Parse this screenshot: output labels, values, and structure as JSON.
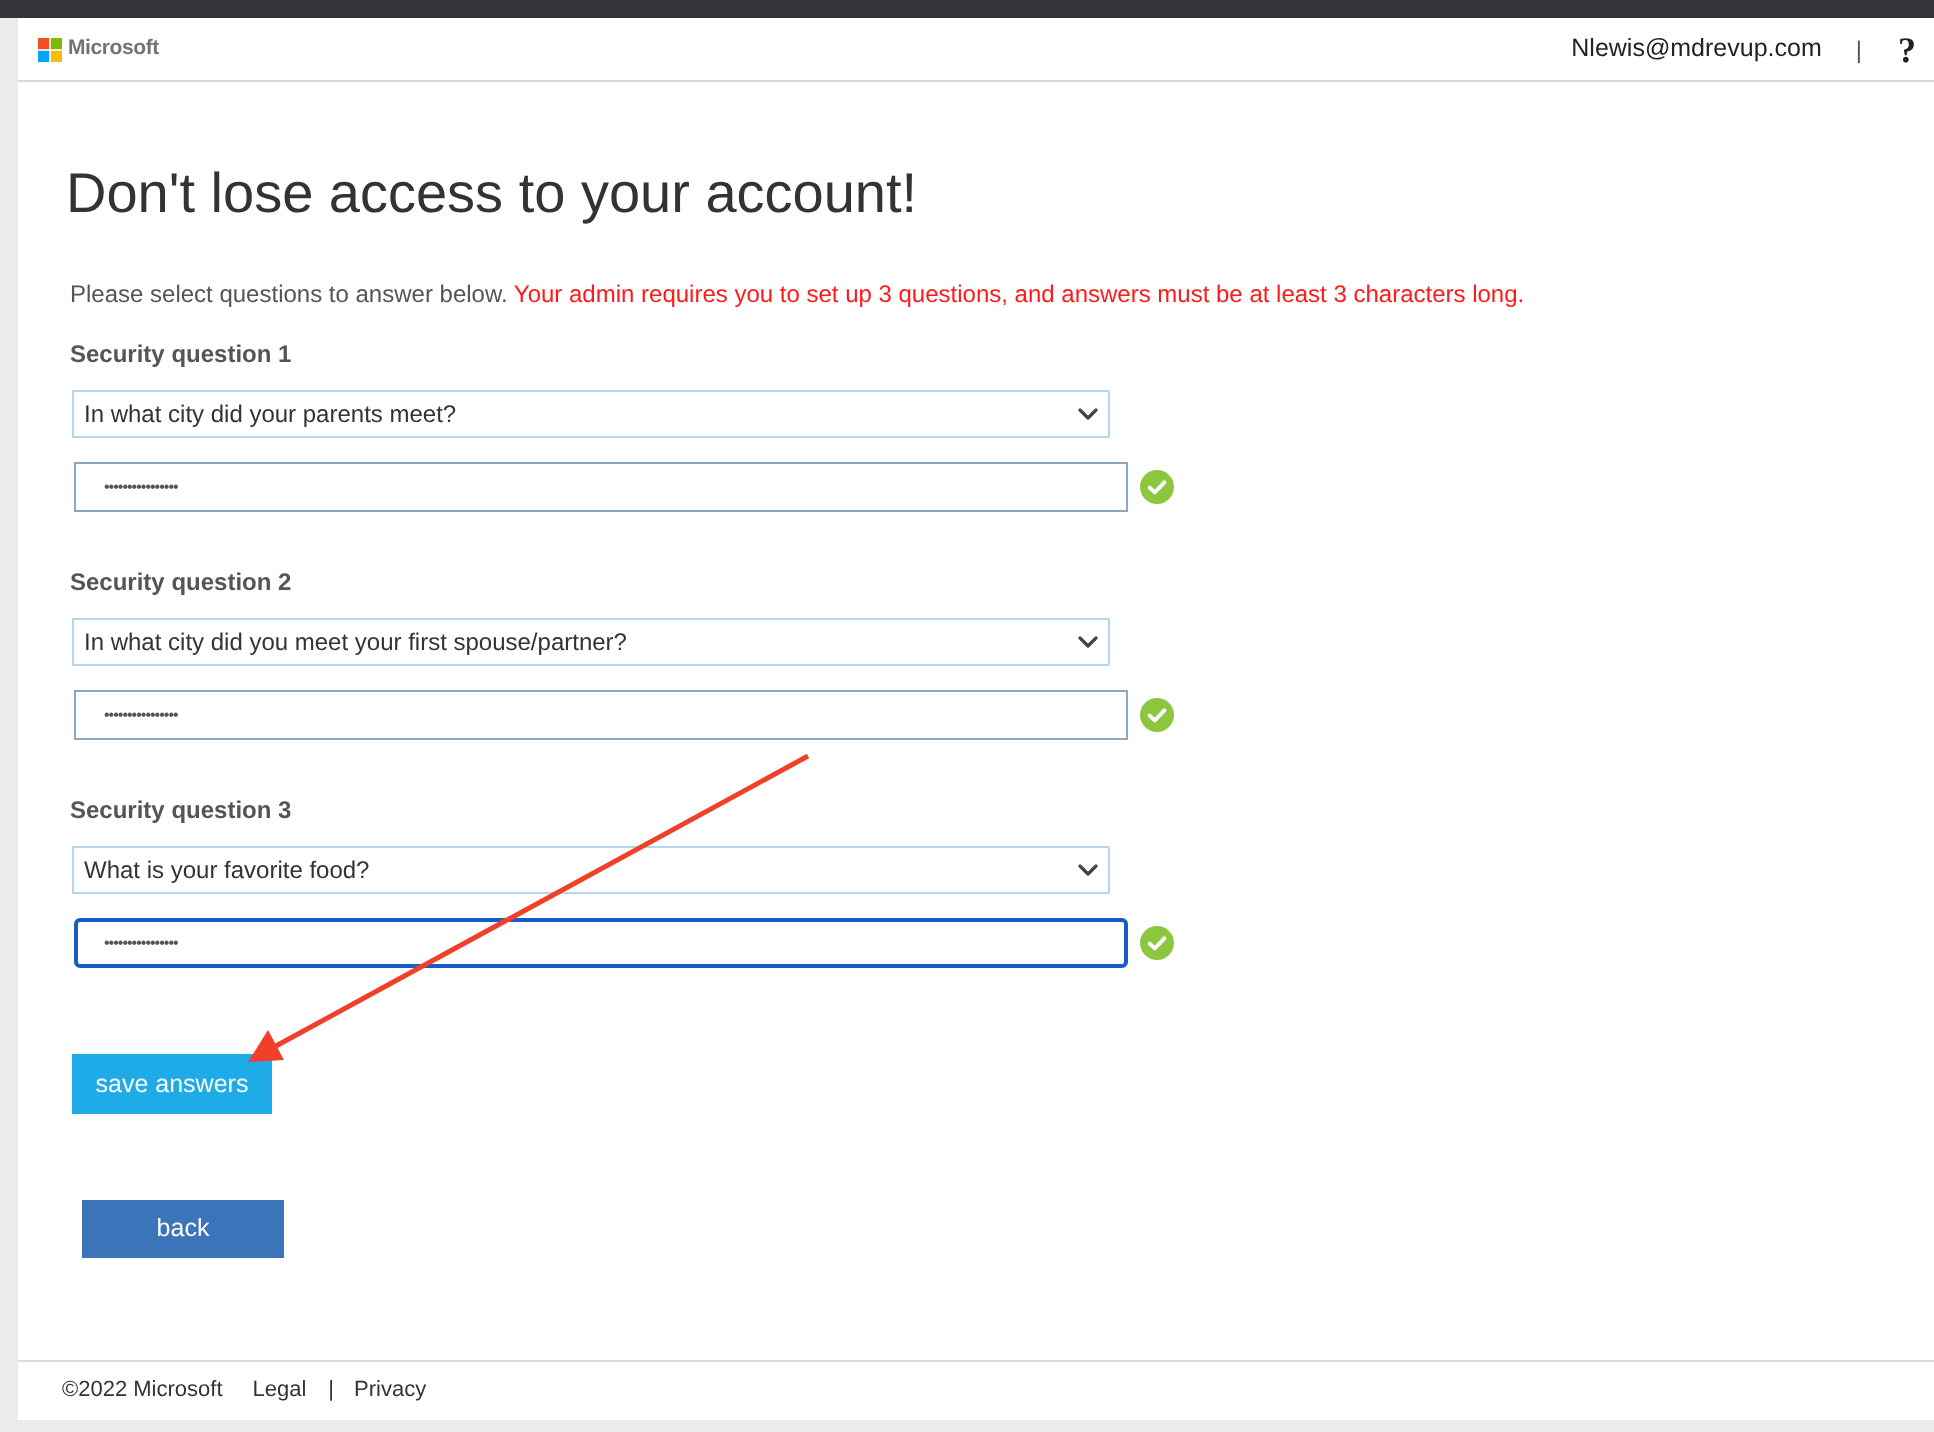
{
  "header": {
    "brand": "Microsoft",
    "user": "Nlewis@mdrevup.com",
    "separator": "|",
    "help": "?"
  },
  "title": "Don't lose access to your account!",
  "intro": {
    "text": "Please select questions to answer below.",
    "warning": "Your admin requires you to set up 3 questions, and answers must be at least 3 characters long."
  },
  "questions": [
    {
      "label": "Security question 1",
      "question": "In what city did your parents meet?",
      "answer": "••••••••••••••••",
      "focused": false,
      "valid": true
    },
    {
      "label": "Security question 2",
      "question": "In what city did you meet your first spouse/partner?",
      "answer": "••••••••••••••••",
      "focused": false,
      "valid": true
    },
    {
      "label": "Security question 3",
      "question": "What is your favorite food?",
      "answer": "••••••••••••••••",
      "focused": true,
      "valid": true
    }
  ],
  "buttons": [
    {
      "label": "save answers",
      "kind": "primary"
    },
    {
      "label": "back",
      "kind": "secondary"
    }
  ],
  "footer": {
    "copyright": "©2022 Microsoft",
    "links": [
      "Legal",
      "Privacy"
    ],
    "separator": "|"
  }
}
